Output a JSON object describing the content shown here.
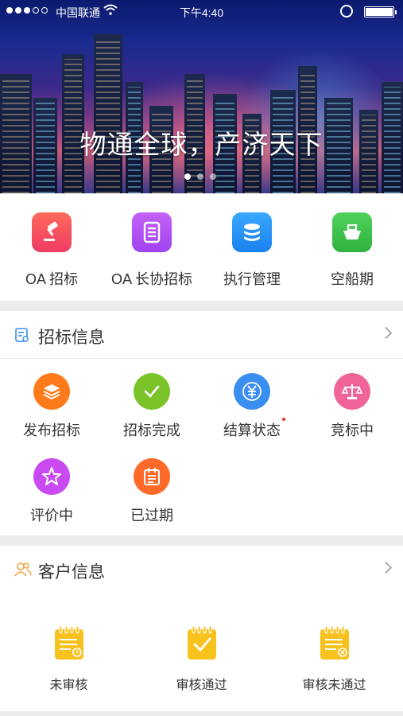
{
  "status_bar": {
    "carrier": "中国联通",
    "time": "下午4:40"
  },
  "banner": {
    "slogan": "物通全球，产济天下",
    "slide_count": 3,
    "active_slide": 1
  },
  "quick_menu": [
    {
      "label": "OA 招标",
      "icon": "gavel-icon",
      "color": "#f0465a"
    },
    {
      "label": "OA 长协招标",
      "icon": "document-list-icon",
      "color": "#b44df0"
    },
    {
      "label": "执行管理",
      "icon": "database-icon",
      "color": "#1f8ff0"
    },
    {
      "label": "空船期",
      "icon": "ship-icon",
      "color": "#3cc24a"
    }
  ],
  "bid_section": {
    "title": "招标信息",
    "items": [
      {
        "label": "发布招标",
        "icon": "layers-icon",
        "color": "#ff7a1a"
      },
      {
        "label": "招标完成",
        "icon": "check-icon",
        "color": "#7ac42a"
      },
      {
        "label": "结算状态",
        "icon": "yuan-icon",
        "color": "#3a8ef0",
        "badge": true
      },
      {
        "label": "竞标中",
        "icon": "scale-icon",
        "color": "#f0649a"
      },
      {
        "label": "评价中",
        "icon": "star-icon",
        "color": "#c84af0"
      },
      {
        "label": "已过期",
        "icon": "calendar-icon",
        "color": "#ff6a2a"
      }
    ]
  },
  "customer_section": {
    "title": "客户信息",
    "items": [
      {
        "label": "未审核",
        "icon": "pending-note-icon"
      },
      {
        "label": "审核通过",
        "icon": "approved-note-icon"
      },
      {
        "label": "审核未通过",
        "icon": "rejected-note-icon"
      }
    ]
  },
  "colors": {
    "accent_yellow": "#f7c21d",
    "customer_icon": "#f3a13a",
    "bid_header_icon": "#3a8ef0"
  }
}
